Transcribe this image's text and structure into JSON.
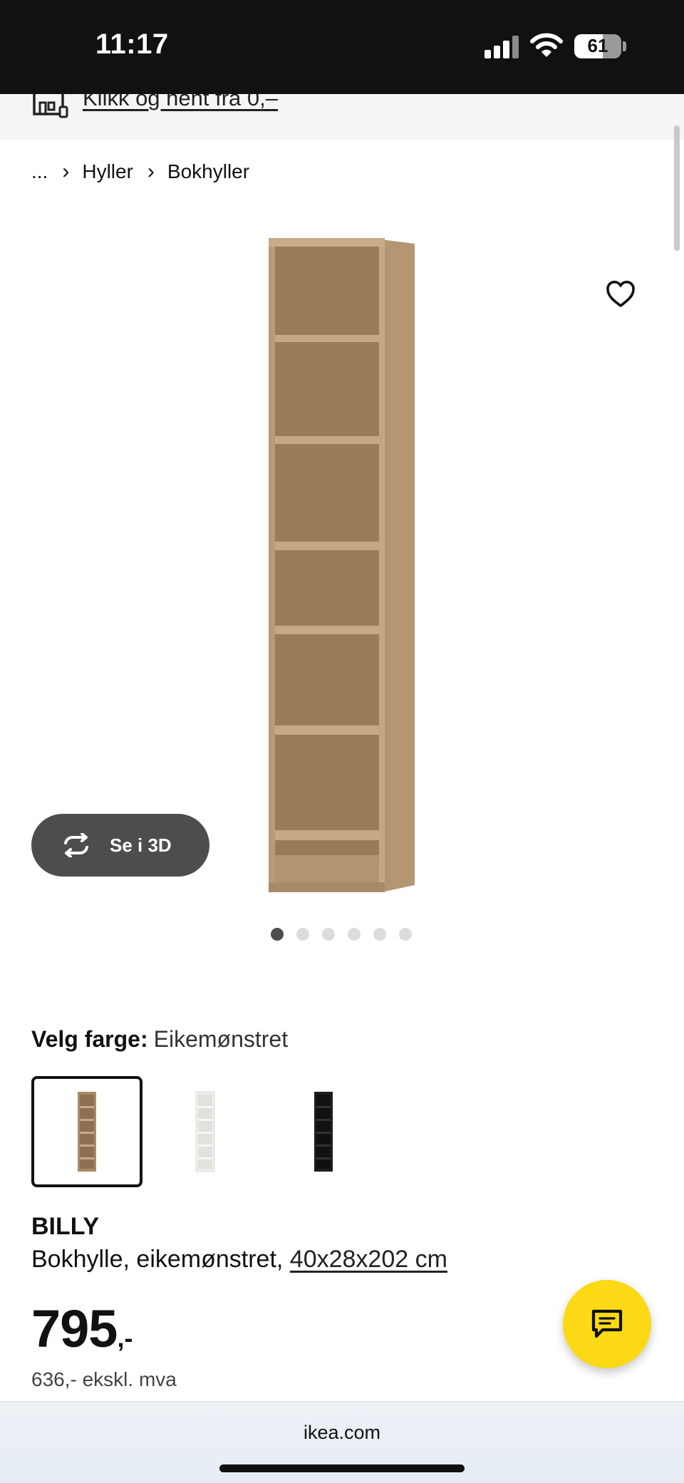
{
  "status_bar": {
    "time": "11:17",
    "battery": "61",
    "battery_level": 0.61,
    "icons": [
      "signal-icon",
      "wifi-icon",
      "battery-icon"
    ]
  },
  "pickup_banner": {
    "icon": "store-pickup-icon",
    "link": "Klikk og hent fra 0,–"
  },
  "breadcrumb": {
    "items": [
      "...",
      "Hyller",
      "Bokhyller"
    ],
    "separator": "›"
  },
  "gallery": {
    "favorite_icon": "heart-icon",
    "view3d_label": "Se i 3D",
    "view3d_icon": "rotate-3d-icon",
    "image_count": 6,
    "active_index": 0
  },
  "color_selection": {
    "label": "Velg farge:",
    "selected": "Eikemønstret",
    "options": [
      {
        "name": "oak-effect",
        "color": "#a98a66"
      },
      {
        "name": "white",
        "color": "#f4f4f2"
      },
      {
        "name": "black",
        "color": "#1e1e1e"
      }
    ]
  },
  "product": {
    "name": "BILLY",
    "description": "Bokhylle, eikemønstret, ",
    "dimensions": "40x28x202 cm",
    "price": "795",
    "price_suffix": ",-",
    "price_ex_vat": "636,- ekskl. mva"
  },
  "chat": {
    "icon": "chat-icon"
  },
  "browser": {
    "url": "ikea.com"
  },
  "colors": {
    "chat_yellow": "#fbd914",
    "button_dark": "#4d4d4d",
    "wood": "#a98a66"
  }
}
